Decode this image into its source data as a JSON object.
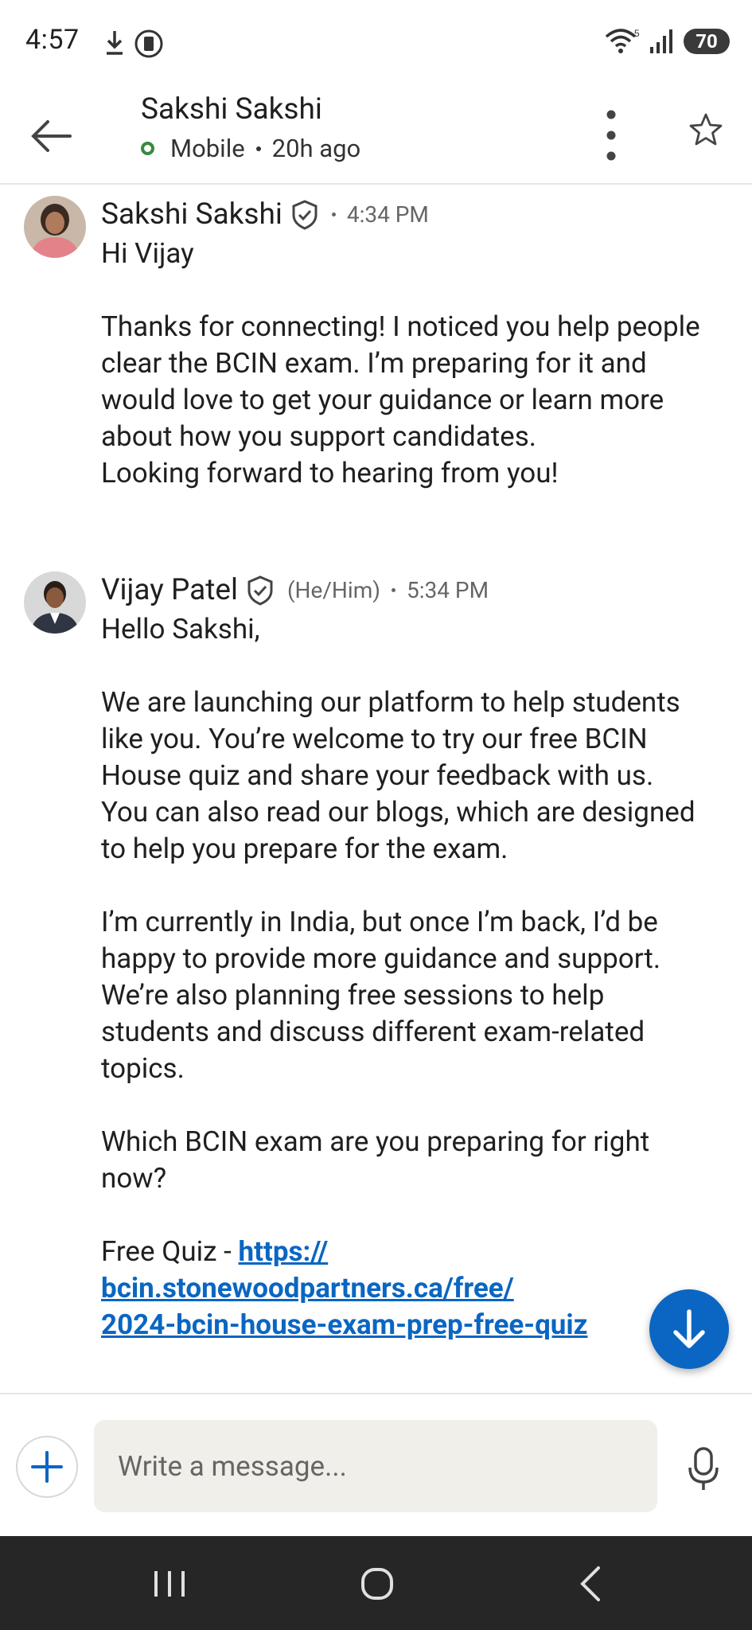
{
  "status_bar": {
    "time": "4:57",
    "battery": "70",
    "icons": [
      "download-icon",
      "screen-record-icon",
      "wifi-icon",
      "signal-icon",
      "battery-icon"
    ]
  },
  "header": {
    "title": "Sakshi Sakshi",
    "status": "Mobile",
    "last_seen": "20h ago"
  },
  "messages": [
    {
      "sender": "Sakshi Sakshi",
      "pronouns": "",
      "time": "4:34 PM",
      "body": "Hi Vijay\n\nThanks for connecting! I noticed you help people clear the BCIN exam. I’m preparing for it and would love to get your guidance or learn more about how you support candidates.\nLooking forward to hearing from you!"
    },
    {
      "sender": "Vijay Patel",
      "pronouns": "(He/Him)",
      "time": "5:34 PM",
      "body": "Hello Sakshi,\n\nWe are launching our platform to help students like you. You’re welcome to try our free BCIN House quiz and share your feedback with us. You can also read our blogs, which are designed to help you prepare for the exam.\n\nI’m currently in India, but once I’m back, I’d be happy to provide more guidance and support. We’re also planning free sessions to help students and discuss different exam-related topics.\n\nWhich BCIN exam are you preparing for right now?\n\n",
      "link_prefix": "Free Quiz - ",
      "link_line1": "https://",
      "link_line2": "bcin.stonewoodpartners.ca/free/",
      "link_line3": "2024-bcin-house-exam-prep-free-quiz"
    }
  ],
  "composer": {
    "placeholder": "Write a message..."
  },
  "colors": {
    "accent": "#0a66c2",
    "online": "#378a3d",
    "navbar": "#262626"
  }
}
